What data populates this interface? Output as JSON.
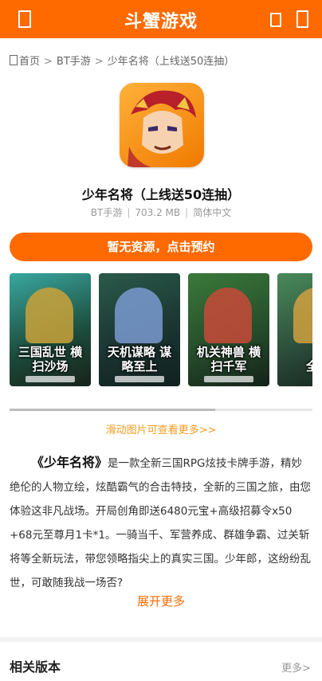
{
  "header": {
    "title": "斗蟹游戏"
  },
  "breadcrumb": {
    "home": "首页",
    "sep": ">",
    "category": "BT手游",
    "current": "少年名将（上线送50连抽）"
  },
  "app": {
    "name": "少年名将（上线送50连抽）",
    "type": "BT手游",
    "size": "703.2 MB",
    "language": "简体中文",
    "divider": "|"
  },
  "download_button": "暂无资源，点击预约",
  "screenshots": [
    {
      "caption": "三国乱世 横扫沙场"
    },
    {
      "caption": "天机谋略 谋略至上"
    },
    {
      "caption": "机关神兽 横扫千军"
    },
    {
      "caption": "全网"
    }
  ],
  "scroll_hint": "滑动图片可查看更多>>",
  "description": {
    "title_quoted": "《少年名将》",
    "body": "是一款全新三国RPG炫技卡牌手游，精妙绝伦的人物立绘，炫酷霸气的合击特技，全新的三国之旅，由您体验这非凡战场。开局创角即送6480元宝+高级招募令x50 +68元至尊月1卡*1。一骑当千、军营养成、群雄争霸、过关斩将等全新玩法，带您领略指尖上的真实三国。少年郎，这纷纷乱世，可敢随我战一场否?"
  },
  "expand_more": "展开更多",
  "related": {
    "title": "相关版本",
    "more": "更多>"
  },
  "colors": {
    "brand": "#ff6a00",
    "hint": "#f29b1c"
  }
}
